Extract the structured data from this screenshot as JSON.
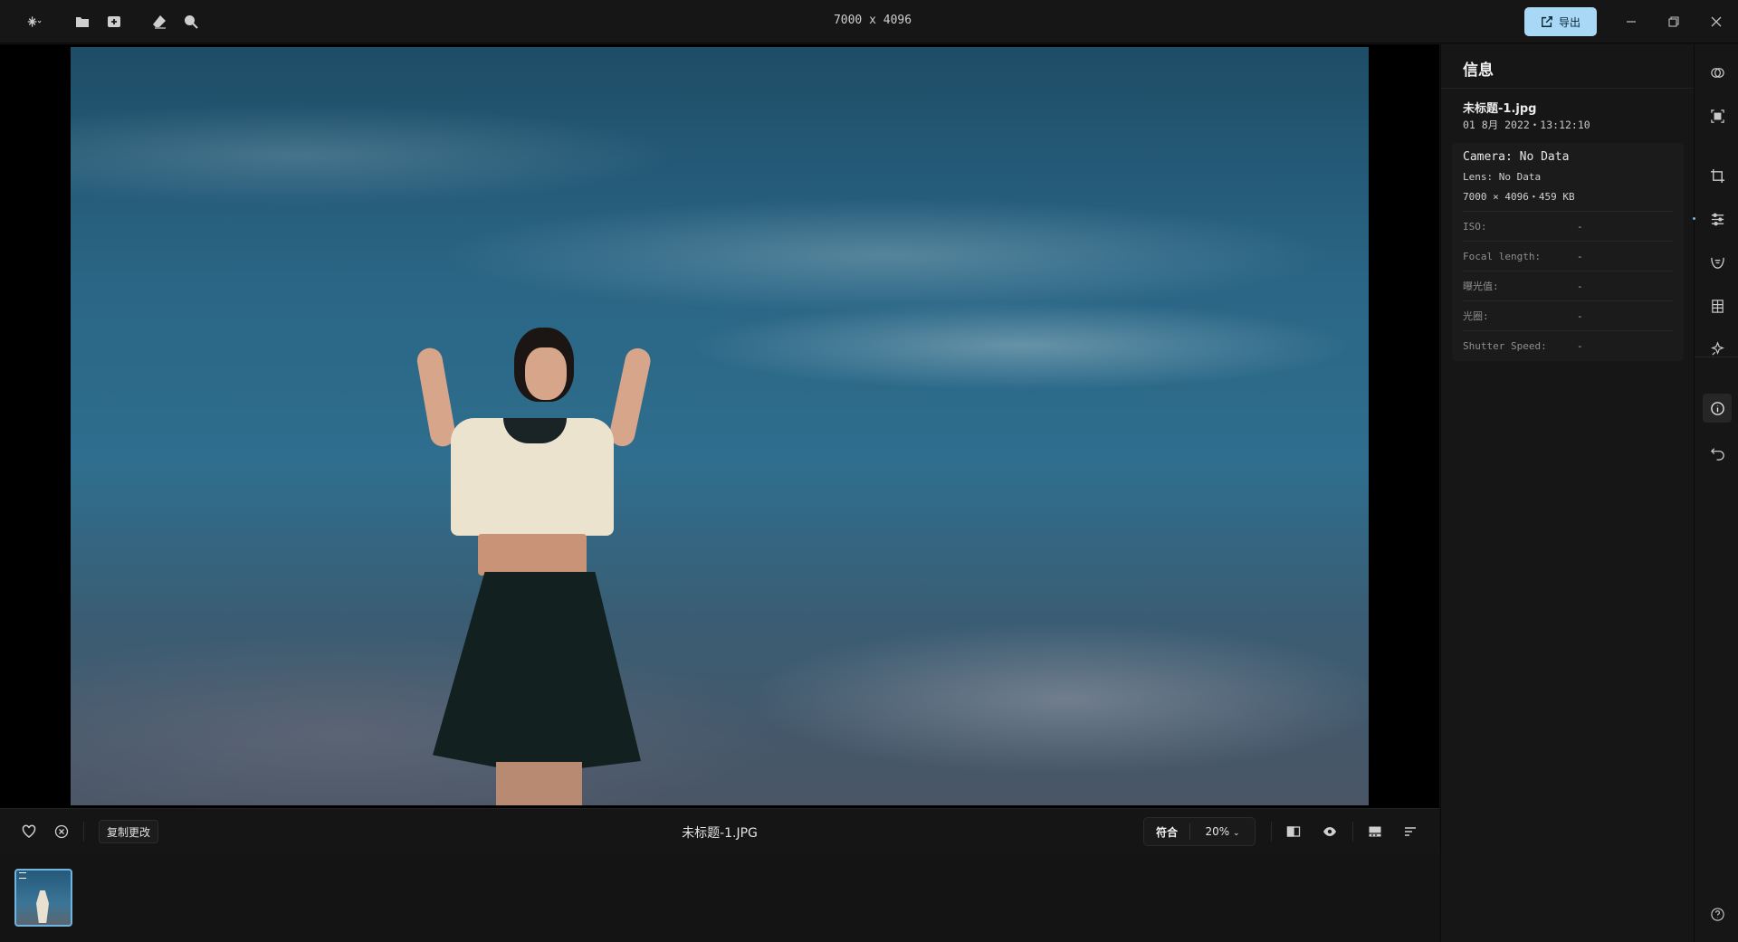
{
  "topbar": {
    "image_dimensions": "7000 x 4096",
    "export_label": "导出",
    "icons": [
      "sparkle-menu-icon",
      "folder-icon",
      "import-icon",
      "eraser-icon",
      "search-icon"
    ]
  },
  "canvas": {
    "photo_description_icon": "photo-image"
  },
  "bottombar": {
    "copy_changes_label": "复制更改",
    "filename": "未标题-1.JPG",
    "fit_label": "符合",
    "zoom_label": "20%"
  },
  "info": {
    "title": "信息",
    "file_name": "未标题-1.jpg",
    "file_date": "01 8月 2022・13:12:10",
    "camera": "Camera: No Data",
    "lens": "Lens: No Data",
    "dims": "7000 × 4096・459 KB",
    "rows": [
      {
        "key": "ISO:",
        "value": "-"
      },
      {
        "key": "Focal length:",
        "value": "-"
      },
      {
        "key": "曝光值:",
        "value": "-"
      },
      {
        "key": "光圈:",
        "value": "-"
      },
      {
        "key": "Shutter Speed:",
        "value": "-"
      }
    ]
  },
  "colors": {
    "accent": "#6fb5e0",
    "export_button": "#a8d8f5",
    "background": "#121212"
  }
}
